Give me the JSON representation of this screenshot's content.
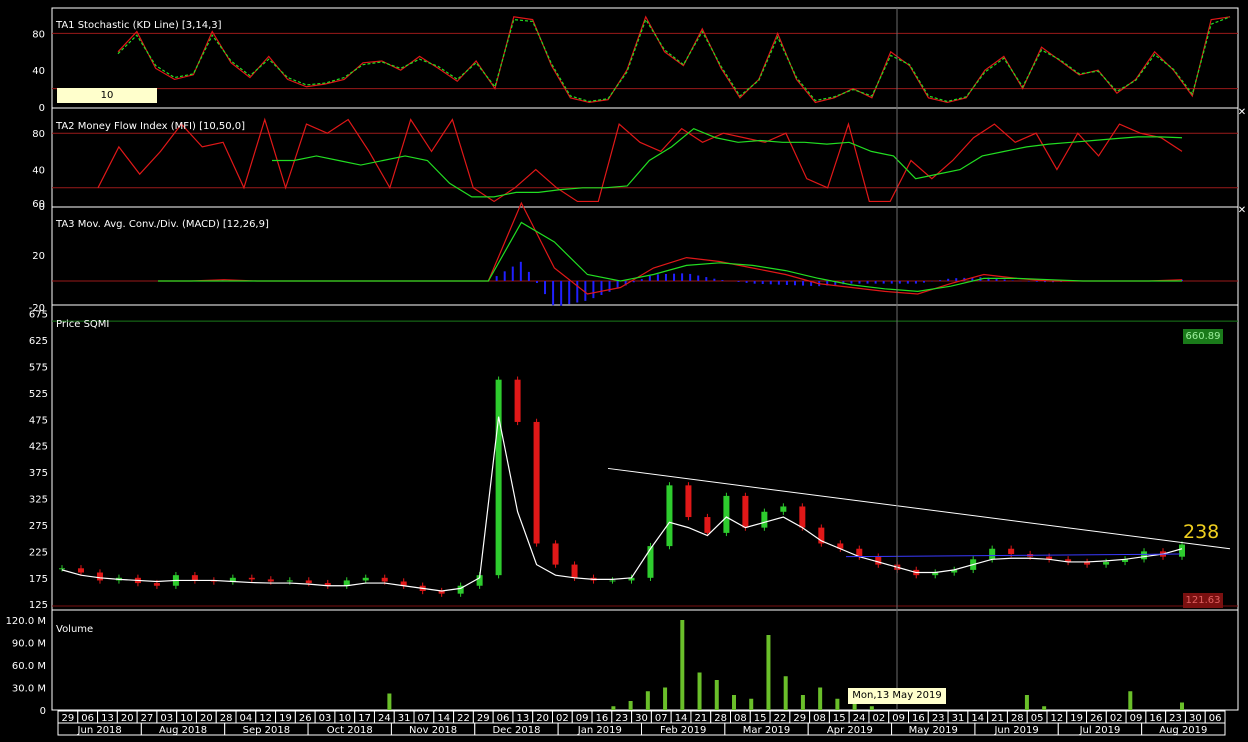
{
  "colors": {
    "up": "#2ecc2e",
    "down": "#e01818",
    "ma": "#ffffff",
    "kd_k": "#e01818",
    "kd_d": "#22dd22",
    "mfi": "#e01818",
    "mfi_sig": "#22dd22",
    "macd": "#e01818",
    "signal": "#22dd22",
    "hist_pos": "#2020ff",
    "hist_neg": "#2020ff",
    "volume": "#6abf2a",
    "grid": "#9a1a1a",
    "crosshair": "#6b6b6b"
  },
  "panels": {
    "stoch": {
      "title": "TA1 Stochastic (KD Line) [3,14,3]",
      "ticks": [
        "80",
        "40",
        "0"
      ],
      "input_value": "10"
    },
    "mfi": {
      "title": "TA2 Money Flow Index (MFI) [10,50,0]",
      "ticks": [
        "80",
        "40",
        "0"
      ]
    },
    "macd": {
      "title": "TA3 Mov. Avg. Conv./Div. (MACD) [12,26,9]",
      "ticks": [
        "60",
        "20",
        "-20"
      ]
    },
    "price": {
      "title": "Price SQMI",
      "ticks": [
        "675",
        "625",
        "575",
        "525",
        "475",
        "425",
        "375",
        "325",
        "275",
        "225",
        "175",
        "125"
      ],
      "high_label": "660.89",
      "low_label": "121.63",
      "last_label": "238"
    },
    "volume": {
      "title": "Volume",
      "ticks": [
        "120.0 M",
        "90.0 M",
        "60.0 M",
        "30.0 M",
        "0"
      ]
    }
  },
  "tooltip": "Mon,13 May 2019",
  "xaxis": {
    "days": [
      "29",
      "06",
      "13",
      "20",
      "27",
      "03",
      "10",
      "20",
      "28",
      "04",
      "12",
      "19",
      "26",
      "03",
      "10",
      "17",
      "24",
      "31",
      "07",
      "14",
      "22",
      "29",
      "06",
      "13",
      "20",
      "02",
      "09",
      "16",
      "23",
      "30",
      "07",
      "14",
      "21",
      "28",
      "08",
      "15",
      "22",
      "29",
      "08",
      "15",
      "24",
      "02",
      "09",
      "16",
      "23",
      "31",
      "14",
      "21",
      "28",
      "05",
      "12",
      "19",
      "26",
      "02",
      "09",
      "16",
      "23",
      "30",
      "06"
    ],
    "months": [
      "Jun 2018",
      "Aug 2018",
      "Sep 2018",
      "Oct 2018",
      "Nov 2018",
      "Dec 2018",
      "Jan 2019",
      "Feb 2019",
      "Mar 2019",
      "Apr 2019",
      "May 2019",
      "Jun 2019",
      "Jul 2019",
      "Aug 2019"
    ]
  },
  "chart_data": [
    {
      "type": "line",
      "title": "TA1 Stochastic (KD Line) [3,14,3]",
      "ylim": [
        0,
        100
      ],
      "series": [
        {
          "name": "K",
          "values": [
            60,
            82,
            42,
            30,
            35,
            82,
            48,
            32,
            55,
            30,
            22,
            25,
            30,
            48,
            50,
            40,
            55,
            42,
            28,
            50,
            20,
            98,
            95,
            45,
            10,
            5,
            8,
            40,
            98,
            60,
            45,
            85,
            42,
            10,
            30,
            80,
            30,
            5,
            10,
            20,
            10,
            60,
            45,
            10,
            5,
            10,
            40,
            55,
            20,
            65,
            50,
            35,
            40,
            15,
            30,
            60,
            40,
            12,
            95,
            98
          ]
        },
        {
          "name": "D",
          "values": [
            58,
            78,
            45,
            32,
            36,
            78,
            50,
            34,
            52,
            32,
            24,
            26,
            32,
            46,
            49,
            42,
            52,
            44,
            30,
            48,
            22,
            95,
            93,
            47,
            12,
            6,
            9,
            38,
            95,
            62,
            46,
            82,
            44,
            12,
            29,
            76,
            32,
            7,
            11,
            19,
            12,
            56,
            46,
            12,
            6,
            11,
            38,
            53,
            22,
            62,
            51,
            36,
            39,
            17,
            29,
            57,
            41,
            14,
            90,
            98
          ]
        }
      ]
    },
    {
      "type": "line",
      "title": "TA2 Money Flow Index (MFI) [10,50,0]",
      "ylim": [
        0,
        100
      ],
      "series": [
        {
          "name": "MFI",
          "values": [
            20,
            65,
            35,
            60,
            90,
            65,
            70,
            20,
            95,
            20,
            90,
            80,
            95,
            60,
            20,
            95,
            60,
            95,
            20,
            5,
            20,
            40,
            20,
            5,
            5,
            90,
            70,
            60,
            85,
            70,
            80,
            75,
            70,
            80,
            30,
            20,
            90,
            5,
            5,
            50,
            30,
            50,
            75,
            90,
            70,
            80,
            40,
            80,
            55,
            90,
            80,
            75,
            60
          ]
        },
        {
          "name": "Signal",
          "values": [
            50,
            50,
            55,
            50,
            45,
            50,
            55,
            50,
            25,
            10,
            10,
            15,
            15,
            18,
            20,
            20,
            22,
            50,
            65,
            85,
            75,
            70,
            72,
            70,
            70,
            68,
            70,
            60,
            55,
            30,
            35,
            40,
            55,
            60,
            65,
            68,
            70,
            72,
            74,
            76,
            76,
            75
          ]
        }
      ]
    },
    {
      "type": "line",
      "title": "TA3 Mov. Avg. Conv./Div. (MACD) [12,26,9]",
      "ylim": [
        -25,
        65
      ],
      "series": [
        {
          "name": "MACD",
          "values": [
            0,
            0,
            1,
            0,
            0,
            0,
            0,
            0,
            0,
            0,
            0,
            60,
            10,
            -10,
            -5,
            10,
            18,
            15,
            10,
            5,
            -2,
            -5,
            -8,
            -10,
            -2,
            5,
            2,
            0,
            0,
            0,
            0,
            1
          ]
        },
        {
          "name": "Signal",
          "values": [
            0,
            0,
            0,
            0,
            0,
            0,
            0,
            0,
            0,
            0,
            0,
            45,
            30,
            5,
            0,
            5,
            12,
            14,
            12,
            8,
            2,
            -3,
            -6,
            -8,
            -4,
            2,
            2,
            1,
            0,
            0,
            0,
            0
          ]
        }
      ]
    },
    {
      "type": "bar",
      "title": "Price SQMI",
      "ylim": [
        121.63,
        680
      ],
      "annotations": [
        "660.89",
        "121.63",
        "238"
      ],
      "series": [
        {
          "name": "Close",
          "values": [
            193,
            185,
            170,
            175,
            165,
            160,
            180,
            170,
            168,
            175,
            172,
            168,
            170,
            165,
            160,
            170,
            175,
            168,
            160,
            150,
            145,
            160,
            180,
            550,
            470,
            240,
            200,
            175,
            170,
            170,
            175,
            235,
            350,
            290,
            260,
            330,
            270,
            300,
            310,
            270,
            240,
            230,
            215,
            200,
            190,
            180,
            185,
            190,
            210,
            230,
            220,
            215,
            210,
            205,
            200,
            205,
            210,
            225,
            215,
            238
          ]
        },
        {
          "name": "Moving Average",
          "values": [
            190,
            180,
            175,
            172,
            170,
            168,
            170,
            170,
            170,
            168,
            166,
            165,
            165,
            163,
            160,
            160,
            165,
            165,
            160,
            155,
            150,
            155,
            175,
            480,
            300,
            200,
            180,
            175,
            172,
            172,
            175,
            230,
            280,
            270,
            255,
            290,
            270,
            280,
            290,
            270,
            245,
            230,
            215,
            205,
            195,
            185,
            185,
            190,
            200,
            210,
            212,
            212,
            210,
            205,
            205,
            207,
            210,
            215,
            220,
            230
          ]
        }
      ]
    },
    {
      "type": "bar",
      "title": "Volume",
      "ylim": [
        0,
        120
      ],
      "series": [
        {
          "name": "Volume (M)",
          "values": [
            0,
            0,
            0,
            0,
            0,
            0,
            0,
            0,
            0,
            0,
            0,
            0,
            0,
            0,
            0,
            0,
            0,
            0,
            0,
            22,
            0,
            0,
            0,
            0,
            0,
            0,
            0,
            0,
            0,
            0,
            0,
            0,
            5,
            12,
            25,
            30,
            120,
            50,
            40,
            20,
            15,
            100,
            45,
            20,
            30,
            15,
            10,
            5,
            0,
            0,
            0,
            0,
            0,
            0,
            0,
            0,
            20,
            5,
            0,
            0,
            0,
            0,
            25,
            0,
            0,
            10
          ]
        }
      ]
    }
  ]
}
